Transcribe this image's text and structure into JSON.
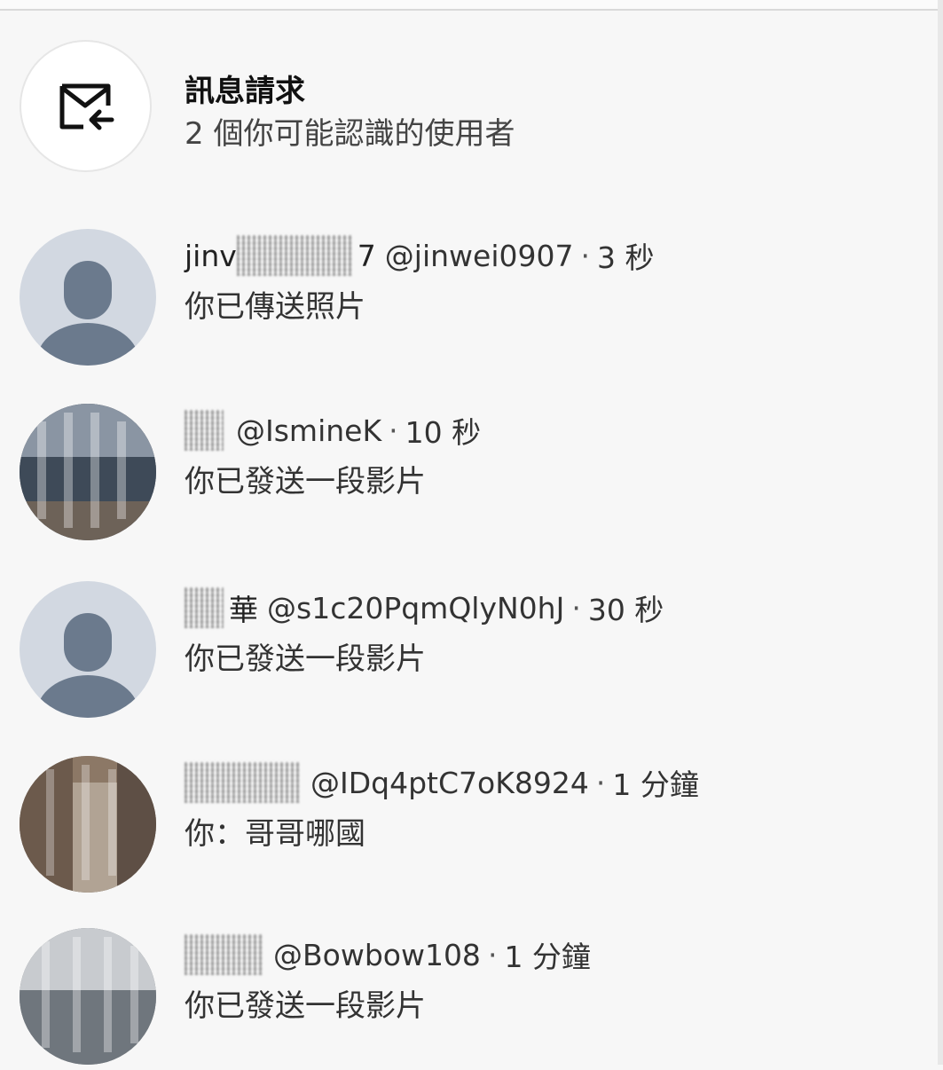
{
  "requests": {
    "title": "訊息請求",
    "subtitle": "2 個你可能認識的使用者",
    "icon": "mail-request-icon"
  },
  "conversations": [
    {
      "name_visible": "jinv",
      "name_suffix": "7",
      "handle": "@jinwei0907",
      "time": "3 秒",
      "preview": "你已傳送照片",
      "avatar": "default"
    },
    {
      "name_visible": "",
      "name_suffix": "",
      "handle": "@IsmineK",
      "time": "10 秒",
      "preview": "你已發送一段影片",
      "avatar": "photo"
    },
    {
      "name_visible": "",
      "name_suffix": "華",
      "handle": "@s1c20PqmQlyN0hJ",
      "time": "30 秒",
      "preview": "你已發送一段影片",
      "avatar": "default"
    },
    {
      "name_visible": "",
      "name_suffix": "",
      "handle": "@IDq4ptC7oK8924",
      "time": "1 分鐘",
      "preview": "你：哥哥哪國",
      "avatar": "photo"
    },
    {
      "name_visible": "",
      "name_suffix": "",
      "handle": "@Bowbow108",
      "time": "1 分鐘",
      "preview": "你已發送一段影片",
      "avatar": "photo"
    }
  ]
}
